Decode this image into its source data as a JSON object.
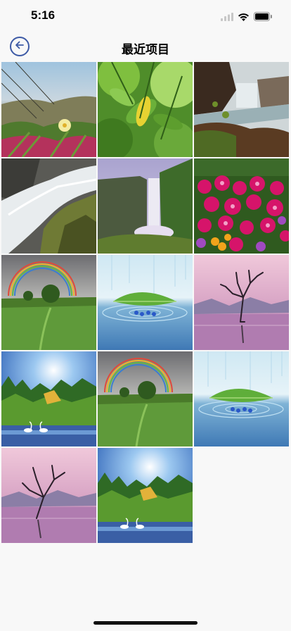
{
  "status_bar": {
    "time": "5:16"
  },
  "nav": {
    "title": "最近项目",
    "back_icon": "back-arrow-circle-icon"
  },
  "photos": [
    {
      "subject": "ice-plant-flower"
    },
    {
      "subject": "green-leaves"
    },
    {
      "subject": "waterfall-cliff"
    },
    {
      "subject": "waterfall-rocks"
    },
    {
      "subject": "waterfall-valley"
    },
    {
      "subject": "pink-flowers"
    },
    {
      "subject": "rainbow-meadow"
    },
    {
      "subject": "leaf-water"
    },
    {
      "subject": "lone-tree-lake"
    },
    {
      "subject": "forest-swans"
    },
    {
      "subject": "rainbow-meadow"
    },
    {
      "subject": "leaf-water"
    },
    {
      "subject": "lone-tree-lake"
    },
    {
      "subject": "forest-swans"
    }
  ]
}
